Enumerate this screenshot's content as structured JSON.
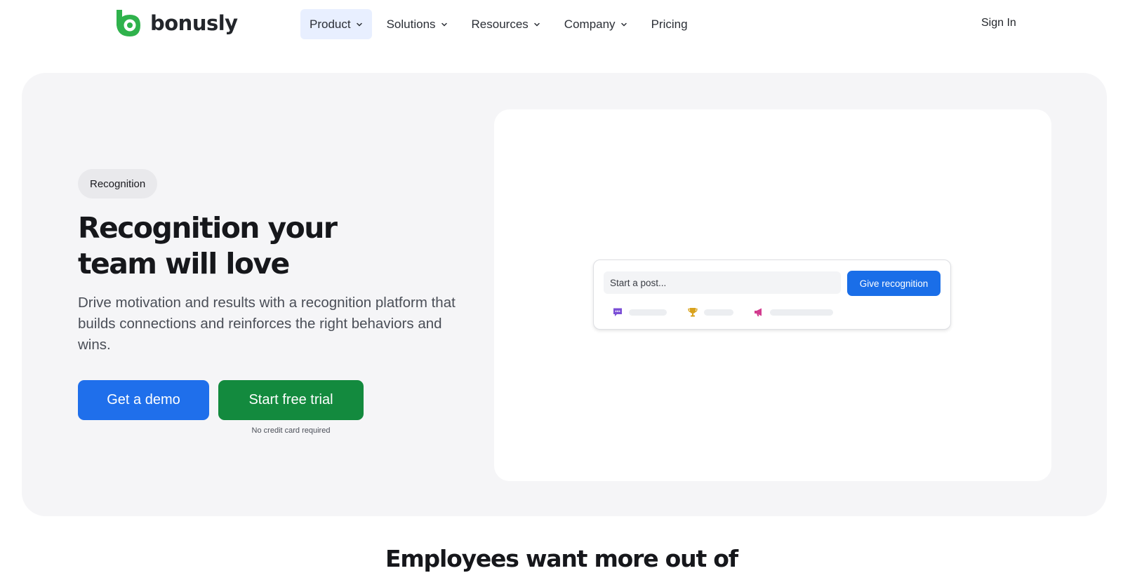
{
  "brand": {
    "name": "bonusly",
    "color": "#2fb24c"
  },
  "nav": {
    "items": [
      {
        "label": "Product",
        "has_dropdown": true,
        "active": true
      },
      {
        "label": "Solutions",
        "has_dropdown": true,
        "active": false
      },
      {
        "label": "Resources",
        "has_dropdown": true,
        "active": false
      },
      {
        "label": "Company",
        "has_dropdown": true,
        "active": false
      },
      {
        "label": "Pricing",
        "has_dropdown": false,
        "active": false
      }
    ],
    "sign_in": "Sign In"
  },
  "hero": {
    "pill": "Recognition",
    "headline_line1": "Recognition your",
    "headline_line2": "team will love",
    "subhead": "Drive motivation and results with a recognition platform that builds connections and reinforces the right behaviors and wins.",
    "demo_button": "Get a demo",
    "trial_button": "Start free trial",
    "trial_note": "No credit card required"
  },
  "composer": {
    "placeholder": "Start a post...",
    "button": "Give recognition",
    "actions": [
      {
        "icon": "chat-icon",
        "color": "#7b4fd6"
      },
      {
        "icon": "trophy-icon",
        "color": "#d9a21c"
      },
      {
        "icon": "megaphone-icon",
        "color": "#d23c8f"
      }
    ]
  },
  "section": {
    "title": "Employees want more out of"
  },
  "colors": {
    "primary_blue": "#1f6feb",
    "trial_green": "#138a3e",
    "hero_bg": "#f5f5f7"
  }
}
